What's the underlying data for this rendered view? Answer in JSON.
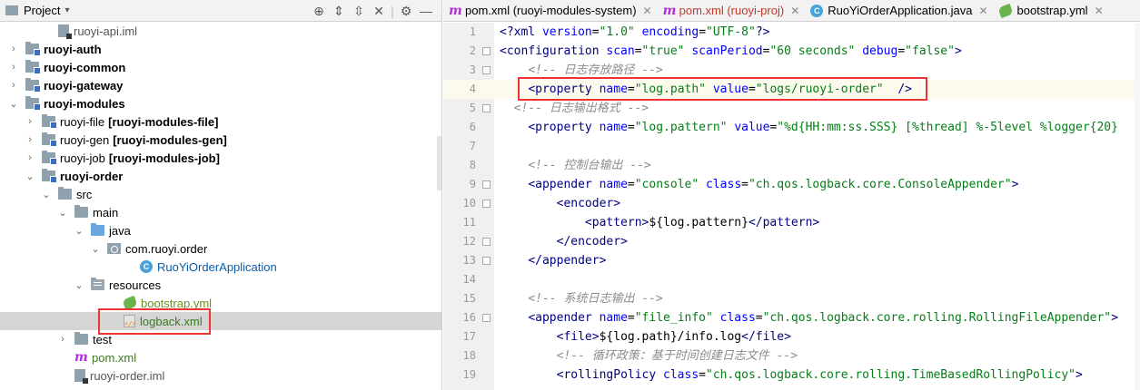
{
  "project_panel": {
    "title": "Project",
    "tree": [
      {
        "indent": 3,
        "arrow": "",
        "icon": "iml",
        "label": "ruoyi-api.iml",
        "style": "gray",
        "tag": ""
      },
      {
        "indent": 1,
        "arrow": "›",
        "icon": "folder-mod",
        "label": "ruoyi-auth",
        "style": "bold",
        "tag": ""
      },
      {
        "indent": 1,
        "arrow": "›",
        "icon": "folder-mod",
        "label": "ruoyi-common",
        "style": "bold",
        "tag": ""
      },
      {
        "indent": 1,
        "arrow": "›",
        "icon": "folder-mod",
        "label": "ruoyi-gateway",
        "style": "bold",
        "tag": ""
      },
      {
        "indent": 1,
        "arrow": "⌄",
        "icon": "folder-mod",
        "label": "ruoyi-modules",
        "style": "bold",
        "tag": ""
      },
      {
        "indent": 2,
        "arrow": "›",
        "icon": "folder-mod",
        "label": "ruoyi-file",
        "style": "",
        "tag": "[ruoyi-modules-file]"
      },
      {
        "indent": 2,
        "arrow": "›",
        "icon": "folder-mod",
        "label": "ruoyi-gen",
        "style": "",
        "tag": "[ruoyi-modules-gen]"
      },
      {
        "indent": 2,
        "arrow": "›",
        "icon": "folder-mod",
        "label": "ruoyi-job",
        "style": "",
        "tag": "[ruoyi-modules-job]"
      },
      {
        "indent": 2,
        "arrow": "⌄",
        "icon": "folder-mod",
        "label": "ruoyi-order",
        "style": "bold",
        "tag": ""
      },
      {
        "indent": 3,
        "arrow": "⌄",
        "icon": "folder",
        "label": "src",
        "style": "",
        "tag": ""
      },
      {
        "indent": 4,
        "arrow": "⌄",
        "icon": "folder",
        "label": "main",
        "style": "",
        "tag": ""
      },
      {
        "indent": 5,
        "arrow": "⌄",
        "icon": "folder-blue",
        "label": "java",
        "style": "",
        "tag": ""
      },
      {
        "indent": 6,
        "arrow": "⌄",
        "icon": "package",
        "label": "com.ruoyi.order",
        "style": "",
        "tag": ""
      },
      {
        "indent": 8,
        "arrow": "",
        "icon": "class",
        "label": "RuoYiOrderApplication",
        "style": "blue",
        "tag": ""
      },
      {
        "indent": 5,
        "arrow": "⌄",
        "icon": "folder-res",
        "label": "resources",
        "style": "",
        "tag": ""
      },
      {
        "indent": 7,
        "arrow": "",
        "icon": "yml",
        "label": "bootstrap.yml",
        "style": "ymlc",
        "tag": ""
      },
      {
        "indent": 7,
        "arrow": "",
        "icon": "xml",
        "label": "logback.xml",
        "style": "green",
        "tag": "",
        "selected": true
      },
      {
        "indent": 4,
        "arrow": "›",
        "icon": "folder",
        "label": "test",
        "style": "",
        "tag": ""
      },
      {
        "indent": 4,
        "arrow": "",
        "icon": "maven",
        "label": "pom.xml",
        "style": "green",
        "tag": ""
      },
      {
        "indent": 4,
        "arrow": "",
        "icon": "iml",
        "label": "ruoyi-order.iml",
        "style": "gray",
        "tag": ""
      }
    ]
  },
  "tabs": [
    {
      "icon": "maven",
      "label": "pom.xml (ruoyi-modules-system)",
      "close": "✕",
      "color": "#000"
    },
    {
      "icon": "maven",
      "label": "pom.xml (ruoyi-proj)",
      "close": "✕",
      "color": "#c0392b"
    },
    {
      "icon": "class",
      "label": "RuoYiOrderApplication.java",
      "close": "✕",
      "color": "#000"
    },
    {
      "icon": "yml",
      "label": "bootstrap.yml",
      "close": "✕",
      "color": "#000"
    }
  ],
  "editor": {
    "lines": [
      {
        "n": "1",
        "parts": [
          [
            "pi",
            "<?"
          ],
          [
            "tag",
            "xml "
          ],
          [
            "attr",
            "version"
          ],
          [
            "plain",
            "="
          ],
          [
            "val",
            "\"1.0\" "
          ],
          [
            "attr",
            "encoding"
          ],
          [
            "plain",
            "="
          ],
          [
            "val",
            "\"UTF-8\""
          ],
          [
            "pi",
            "?>"
          ]
        ]
      },
      {
        "n": "2",
        "parts": [
          [
            "tag",
            "<configuration "
          ],
          [
            "attr",
            "scan"
          ],
          [
            "plain",
            "="
          ],
          [
            "val",
            "\"true\" "
          ],
          [
            "attr",
            "scanPeriod"
          ],
          [
            "plain",
            "="
          ],
          [
            "val",
            "\"60 seconds\" "
          ],
          [
            "attr",
            "debug"
          ],
          [
            "plain",
            "="
          ],
          [
            "val",
            "\"false\""
          ],
          [
            "tag",
            ">"
          ]
        ]
      },
      {
        "n": "3",
        "parts": [
          [
            "plain",
            "    "
          ],
          [
            "cmt",
            "<!-- 日志存放路径 -->"
          ]
        ]
      },
      {
        "n": "4",
        "parts": [
          [
            "plain",
            "    "
          ],
          [
            "tag",
            "<property "
          ],
          [
            "attr",
            "name"
          ],
          [
            "plain",
            "="
          ],
          [
            "val",
            "\"log.path\" "
          ],
          [
            "attr",
            "value"
          ],
          [
            "plain",
            "="
          ],
          [
            "val",
            "\"logs/ruoyi-order\""
          ],
          [
            "plain",
            "  "
          ],
          [
            "tag",
            "/>"
          ]
        ]
      },
      {
        "n": "5",
        "parts": [
          [
            "plain",
            "  "
          ],
          [
            "cmt",
            "<!-- 日志输出格式 -->"
          ]
        ]
      },
      {
        "n": "6",
        "parts": [
          [
            "plain",
            "    "
          ],
          [
            "tag",
            "<property "
          ],
          [
            "attr",
            "name"
          ],
          [
            "plain",
            "="
          ],
          [
            "val",
            "\"log.pattern\" "
          ],
          [
            "attr",
            "value"
          ],
          [
            "plain",
            "="
          ],
          [
            "val",
            "\"%d{HH:mm:ss.SSS} [%thread] %-5level %logger{20}"
          ]
        ]
      },
      {
        "n": "7",
        "parts": []
      },
      {
        "n": "8",
        "parts": [
          [
            "plain",
            "    "
          ],
          [
            "cmt",
            "<!-- 控制台输出 -->"
          ]
        ]
      },
      {
        "n": "9",
        "parts": [
          [
            "plain",
            "    "
          ],
          [
            "tag",
            "<appender "
          ],
          [
            "attr",
            "name"
          ],
          [
            "plain",
            "="
          ],
          [
            "val",
            "\"console\" "
          ],
          [
            "attr",
            "class"
          ],
          [
            "plain",
            "="
          ],
          [
            "val",
            "\"ch.qos.logback.core.ConsoleAppender\""
          ],
          [
            "tag",
            ">"
          ]
        ]
      },
      {
        "n": "10",
        "parts": [
          [
            "plain",
            "        "
          ],
          [
            "tag",
            "<encoder>"
          ]
        ]
      },
      {
        "n": "11",
        "parts": [
          [
            "plain",
            "            "
          ],
          [
            "tag",
            "<pattern>"
          ],
          [
            "plain",
            "${log.pattern}"
          ],
          [
            "tag",
            "</pattern>"
          ]
        ]
      },
      {
        "n": "12",
        "parts": [
          [
            "plain",
            "        "
          ],
          [
            "tag",
            "</encoder>"
          ]
        ]
      },
      {
        "n": "13",
        "parts": [
          [
            "plain",
            "    "
          ],
          [
            "tag",
            "</appender>"
          ]
        ]
      },
      {
        "n": "14",
        "parts": []
      },
      {
        "n": "15",
        "parts": [
          [
            "plain",
            "    "
          ],
          [
            "cmt",
            "<!-- 系统日志输出 -->"
          ]
        ]
      },
      {
        "n": "16",
        "parts": [
          [
            "plain",
            "    "
          ],
          [
            "tag",
            "<appender "
          ],
          [
            "attr",
            "name"
          ],
          [
            "plain",
            "="
          ],
          [
            "val",
            "\"file_info\" "
          ],
          [
            "attr",
            "class"
          ],
          [
            "plain",
            "="
          ],
          [
            "val",
            "\"ch.qos.logback.core.rolling.RollingFileAppender\""
          ],
          [
            "tag",
            ">"
          ]
        ]
      },
      {
        "n": "17",
        "parts": [
          [
            "plain",
            "        "
          ],
          [
            "tag",
            "<file>"
          ],
          [
            "plain",
            "${log.path}/info.log"
          ],
          [
            "tag",
            "</file>"
          ]
        ]
      },
      {
        "n": "18",
        "parts": [
          [
            "plain",
            "        "
          ],
          [
            "cmt",
            "<!-- 循环政策：基于时间创建日志文件 -->"
          ]
        ]
      },
      {
        "n": "19",
        "parts": [
          [
            "plain",
            "        "
          ],
          [
            "tag",
            "<rollingPolicy "
          ],
          [
            "attr",
            "class"
          ],
          [
            "plain",
            "="
          ],
          [
            "val",
            "\"ch.qos.logback.core.rolling.TimeBasedRollingPolicy\""
          ],
          [
            "tag",
            ">"
          ]
        ]
      }
    ]
  }
}
